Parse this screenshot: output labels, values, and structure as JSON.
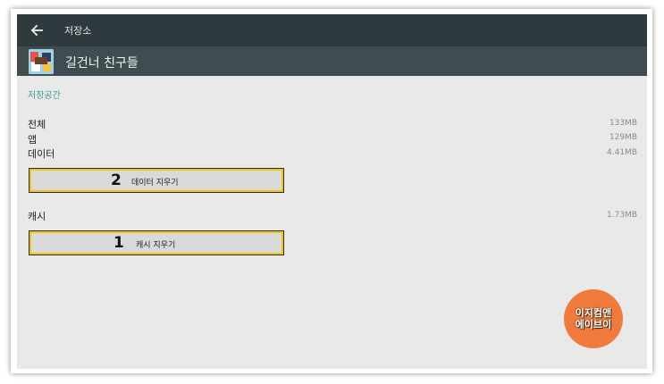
{
  "toolbar": {
    "back_icon": "arrow-left-icon",
    "title": "저장소"
  },
  "app": {
    "icon": "app-icon",
    "name": "길건너 친구들"
  },
  "storage": {
    "section_title": "저장공간",
    "rows": [
      {
        "label": "전체",
        "value": "133MB"
      },
      {
        "label": "앱",
        "value": "129MB"
      },
      {
        "label": "데이터",
        "value": "4.41MB"
      }
    ],
    "clear_data": {
      "number": "2",
      "label": "데이터 지우기"
    },
    "cache": {
      "label": "캐시",
      "value": "1.73MB"
    },
    "clear_cache": {
      "number": "1",
      "label": "캐시 지우기"
    }
  },
  "badge": {
    "line1": "이지컴앤",
    "line2": "에이브이"
  },
  "colors": {
    "toolbar": "#2f3a3e",
    "app_header": "#3f4d50",
    "accent": "#3a9a8e",
    "highlight_border": "#f1c40f",
    "badge": "#f07a3c"
  }
}
